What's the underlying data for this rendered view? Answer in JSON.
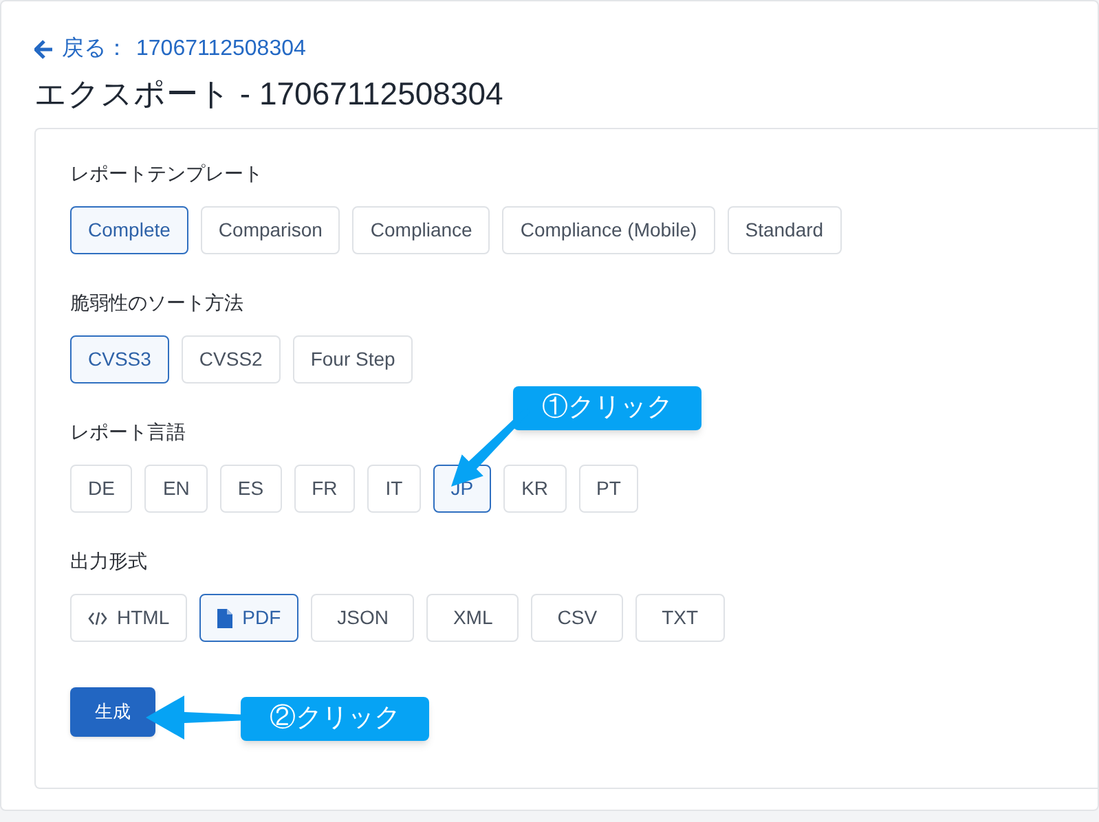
{
  "back_link": {
    "label": "戻る：",
    "id_text": "17067112508304"
  },
  "title": "エクスポート - 17067112508304",
  "sections": [
    {
      "label": "レポートテンプレート",
      "options": [
        {
          "label": "Complete",
          "selected": true
        },
        {
          "label": "Comparison",
          "selected": false
        },
        {
          "label": "Compliance",
          "selected": false
        },
        {
          "label": "Compliance (Mobile)",
          "selected": false
        },
        {
          "label": "Standard",
          "selected": false
        }
      ]
    },
    {
      "label": "脆弱性のソート方法",
      "options": [
        {
          "label": "CVSS3",
          "selected": true
        },
        {
          "label": "CVSS2",
          "selected": false
        },
        {
          "label": "Four Step",
          "selected": false
        }
      ]
    },
    {
      "label": "レポート言語",
      "options": [
        {
          "label": "DE",
          "selected": false
        },
        {
          "label": "EN",
          "selected": false
        },
        {
          "label": "ES",
          "selected": false
        },
        {
          "label": "FR",
          "selected": false
        },
        {
          "label": "IT",
          "selected": false
        },
        {
          "label": "JP",
          "selected": true
        },
        {
          "label": "KR",
          "selected": false
        },
        {
          "label": "PT",
          "selected": false
        }
      ]
    },
    {
      "label": "出力形式",
      "options": [
        {
          "label": "HTML",
          "selected": false,
          "kind": "code"
        },
        {
          "label": "PDF",
          "selected": true,
          "kind": "file"
        },
        {
          "label": "JSON",
          "selected": false,
          "kind": "text"
        },
        {
          "label": "XML",
          "selected": false,
          "kind": "text"
        },
        {
          "label": "CSV",
          "selected": false,
          "kind": "text"
        },
        {
          "label": "TXT",
          "selected": false,
          "kind": "text"
        }
      ]
    }
  ],
  "generate_button": "生成",
  "annotations": [
    {
      "text": "①クリック"
    },
    {
      "text": "②クリック"
    }
  ]
}
